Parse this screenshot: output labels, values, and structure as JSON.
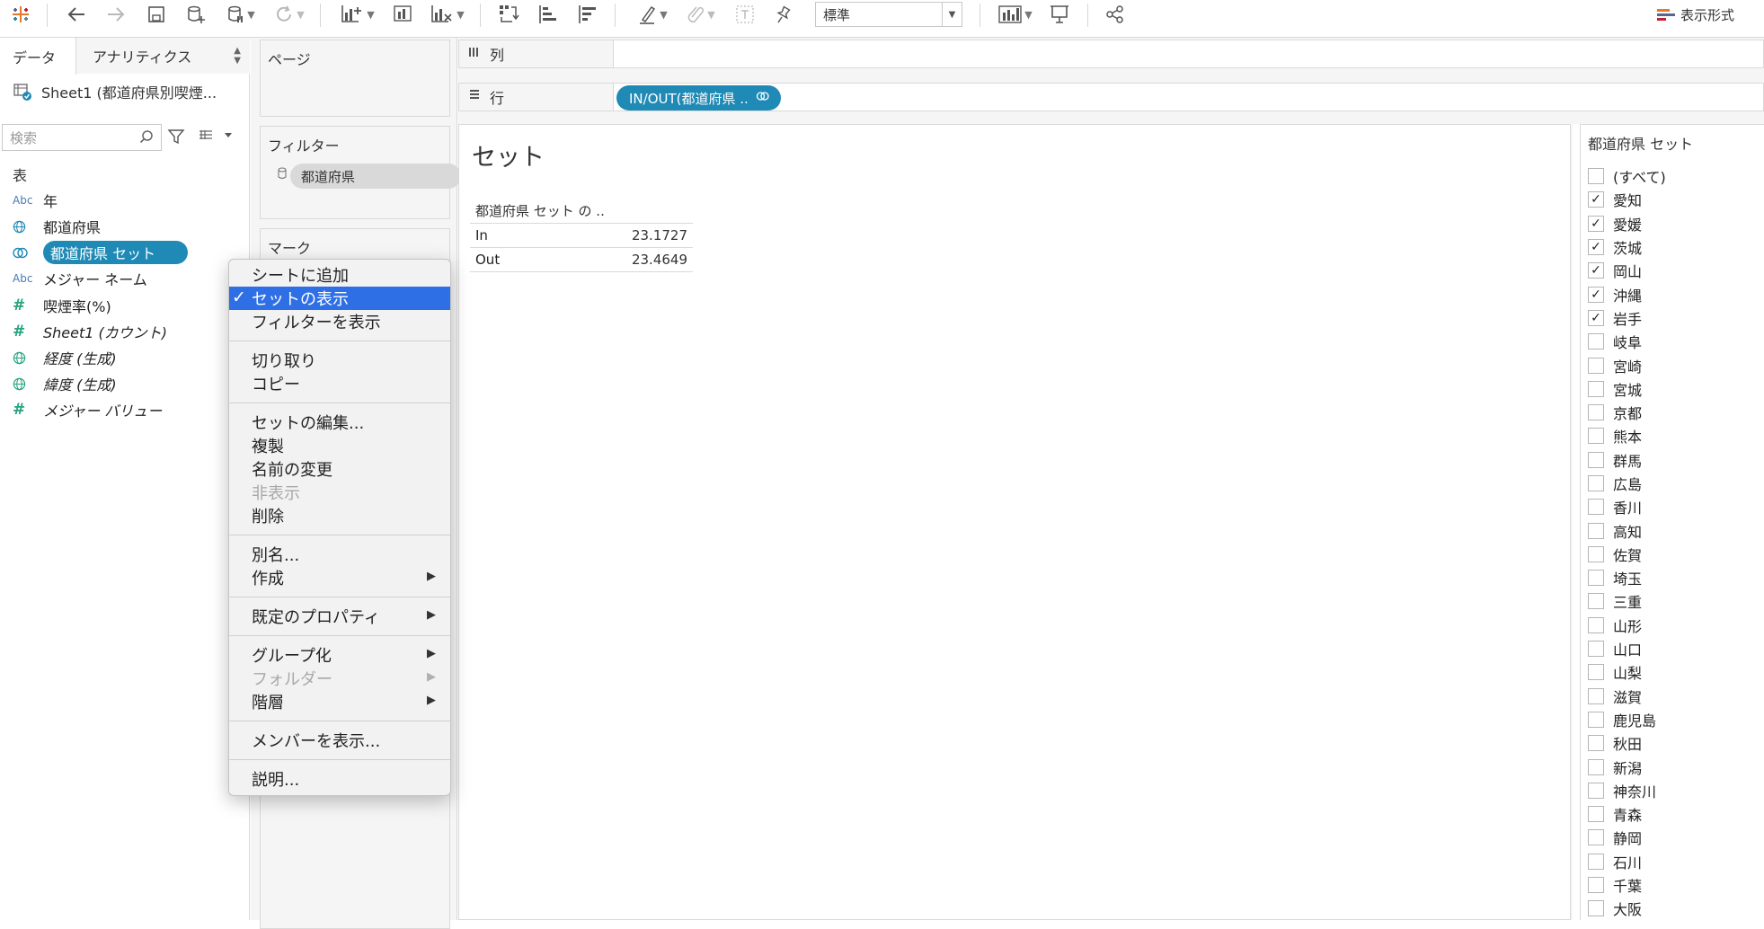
{
  "toolbar": {
    "standard_dropdown": "標準",
    "show_me_label": "表示形式"
  },
  "left_pane": {
    "tab_data": "データ",
    "tab_analytics": "アナリティクス",
    "datasource": "Sheet1 (都道府県別喫煙...",
    "search_placeholder": "検索",
    "section_table": "表",
    "fields": [
      {
        "label": "年",
        "type": "Abc"
      },
      {
        "label": "都道府県",
        "type": "globe"
      },
      {
        "label": "都道府県 セット",
        "type": "set"
      },
      {
        "label": "メジャー ネーム",
        "type": "Abc"
      },
      {
        "label": "喫煙率(%)",
        "type": "#"
      },
      {
        "label": "Sheet1 (カウント)",
        "type": "#"
      },
      {
        "label": "経度 (生成)",
        "type": "globe"
      },
      {
        "label": "緯度 (生成)",
        "type": "globe"
      },
      {
        "label": "メジャー バリュー",
        "type": "#"
      }
    ]
  },
  "cards": {
    "pages": "ページ",
    "filters": "フィルター",
    "filter_pill": "都道府県",
    "marks": "マーク"
  },
  "shelves": {
    "columns": "列",
    "rows": "行",
    "row_pill": "IN/OUT(都道府県 .."
  },
  "view": {
    "title": "セット",
    "table_header": "都道府県 セット の ..",
    "rows": [
      {
        "label": "In",
        "value": "23.1727"
      },
      {
        "label": "Out",
        "value": "23.4649"
      }
    ]
  },
  "set_card": {
    "title": "都道府県 セット",
    "items": [
      {
        "label": "(すべて)",
        "checked": false
      },
      {
        "label": "愛知",
        "checked": true
      },
      {
        "label": "愛媛",
        "checked": true
      },
      {
        "label": "茨城",
        "checked": true
      },
      {
        "label": "岡山",
        "checked": true
      },
      {
        "label": "沖縄",
        "checked": true
      },
      {
        "label": "岩手",
        "checked": true
      },
      {
        "label": "岐阜",
        "checked": false
      },
      {
        "label": "宮崎",
        "checked": false
      },
      {
        "label": "宮城",
        "checked": false
      },
      {
        "label": "京都",
        "checked": false
      },
      {
        "label": "熊本",
        "checked": false
      },
      {
        "label": "群馬",
        "checked": false
      },
      {
        "label": "広島",
        "checked": false
      },
      {
        "label": "香川",
        "checked": false
      },
      {
        "label": "高知",
        "checked": false
      },
      {
        "label": "佐賀",
        "checked": false
      },
      {
        "label": "埼玉",
        "checked": false
      },
      {
        "label": "三重",
        "checked": false
      },
      {
        "label": "山形",
        "checked": false
      },
      {
        "label": "山口",
        "checked": false
      },
      {
        "label": "山梨",
        "checked": false
      },
      {
        "label": "滋賀",
        "checked": false
      },
      {
        "label": "鹿児島",
        "checked": false
      },
      {
        "label": "秋田",
        "checked": false
      },
      {
        "label": "新潟",
        "checked": false
      },
      {
        "label": "神奈川",
        "checked": false
      },
      {
        "label": "青森",
        "checked": false
      },
      {
        "label": "静岡",
        "checked": false
      },
      {
        "label": "石川",
        "checked": false
      },
      {
        "label": "千葉",
        "checked": false
      },
      {
        "label": "大阪",
        "checked": false
      }
    ]
  },
  "context_menu": {
    "add_to_sheet": "シートに追加",
    "show_set": "セットの表示",
    "show_filter": "フィルターを表示",
    "cut": "切り取り",
    "copy": "コピー",
    "edit_set": "セットの編集...",
    "duplicate": "複製",
    "rename": "名前の変更",
    "hide": "非表示",
    "delete": "削除",
    "aliases": "別名...",
    "create": "作成",
    "default_properties": "既定のプロパティ",
    "group_by": "グループ化",
    "folders": "フォルダー",
    "hierarchy": "階層",
    "show_members": "メンバーを表示...",
    "describe": "説明..."
  },
  "colors": {
    "pill_blue": "#1f8ab5",
    "menu_highlight": "#2f6fe5"
  }
}
